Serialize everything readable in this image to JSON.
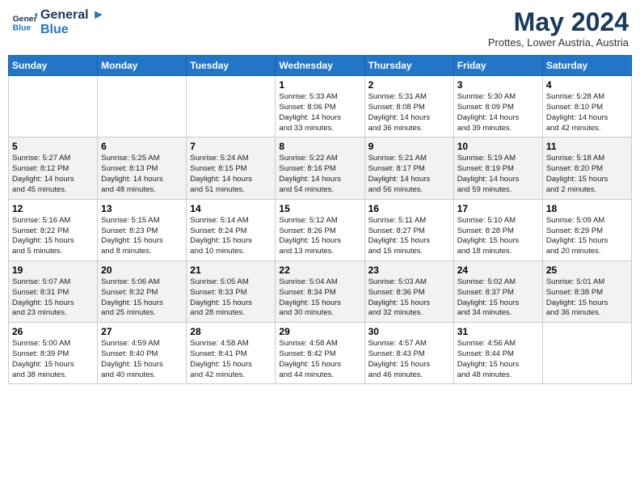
{
  "logo": {
    "line1": "General",
    "line2": "Blue"
  },
  "title": "May 2024",
  "subtitle": "Prottes, Lower Austria, Austria",
  "days_of_week": [
    "Sunday",
    "Monday",
    "Tuesday",
    "Wednesday",
    "Thursday",
    "Friday",
    "Saturday"
  ],
  "weeks": [
    [
      {
        "day": "",
        "info": ""
      },
      {
        "day": "",
        "info": ""
      },
      {
        "day": "",
        "info": ""
      },
      {
        "day": "1",
        "info": "Sunrise: 5:33 AM\nSunset: 8:06 PM\nDaylight: 14 hours\nand 33 minutes."
      },
      {
        "day": "2",
        "info": "Sunrise: 5:31 AM\nSunset: 8:08 PM\nDaylight: 14 hours\nand 36 minutes."
      },
      {
        "day": "3",
        "info": "Sunrise: 5:30 AM\nSunset: 8:09 PM\nDaylight: 14 hours\nand 39 minutes."
      },
      {
        "day": "4",
        "info": "Sunrise: 5:28 AM\nSunset: 8:10 PM\nDaylight: 14 hours\nand 42 minutes."
      }
    ],
    [
      {
        "day": "5",
        "info": "Sunrise: 5:27 AM\nSunset: 8:12 PM\nDaylight: 14 hours\nand 45 minutes."
      },
      {
        "day": "6",
        "info": "Sunrise: 5:25 AM\nSunset: 8:13 PM\nDaylight: 14 hours\nand 48 minutes."
      },
      {
        "day": "7",
        "info": "Sunrise: 5:24 AM\nSunset: 8:15 PM\nDaylight: 14 hours\nand 51 minutes."
      },
      {
        "day": "8",
        "info": "Sunrise: 5:22 AM\nSunset: 8:16 PM\nDaylight: 14 hours\nand 54 minutes."
      },
      {
        "day": "9",
        "info": "Sunrise: 5:21 AM\nSunset: 8:17 PM\nDaylight: 14 hours\nand 56 minutes."
      },
      {
        "day": "10",
        "info": "Sunrise: 5:19 AM\nSunset: 8:19 PM\nDaylight: 14 hours\nand 59 minutes."
      },
      {
        "day": "11",
        "info": "Sunrise: 5:18 AM\nSunset: 8:20 PM\nDaylight: 15 hours\nand 2 minutes."
      }
    ],
    [
      {
        "day": "12",
        "info": "Sunrise: 5:16 AM\nSunset: 8:22 PM\nDaylight: 15 hours\nand 5 minutes."
      },
      {
        "day": "13",
        "info": "Sunrise: 5:15 AM\nSunset: 8:23 PM\nDaylight: 15 hours\nand 8 minutes."
      },
      {
        "day": "14",
        "info": "Sunrise: 5:14 AM\nSunset: 8:24 PM\nDaylight: 15 hours\nand 10 minutes."
      },
      {
        "day": "15",
        "info": "Sunrise: 5:12 AM\nSunset: 8:26 PM\nDaylight: 15 hours\nand 13 minutes."
      },
      {
        "day": "16",
        "info": "Sunrise: 5:11 AM\nSunset: 8:27 PM\nDaylight: 15 hours\nand 15 minutes."
      },
      {
        "day": "17",
        "info": "Sunrise: 5:10 AM\nSunset: 8:28 PM\nDaylight: 15 hours\nand 18 minutes."
      },
      {
        "day": "18",
        "info": "Sunrise: 5:09 AM\nSunset: 8:29 PM\nDaylight: 15 hours\nand 20 minutes."
      }
    ],
    [
      {
        "day": "19",
        "info": "Sunrise: 5:07 AM\nSunset: 8:31 PM\nDaylight: 15 hours\nand 23 minutes."
      },
      {
        "day": "20",
        "info": "Sunrise: 5:06 AM\nSunset: 8:32 PM\nDaylight: 15 hours\nand 25 minutes."
      },
      {
        "day": "21",
        "info": "Sunrise: 5:05 AM\nSunset: 8:33 PM\nDaylight: 15 hours\nand 28 minutes."
      },
      {
        "day": "22",
        "info": "Sunrise: 5:04 AM\nSunset: 8:34 PM\nDaylight: 15 hours\nand 30 minutes."
      },
      {
        "day": "23",
        "info": "Sunrise: 5:03 AM\nSunset: 8:36 PM\nDaylight: 15 hours\nand 32 minutes."
      },
      {
        "day": "24",
        "info": "Sunrise: 5:02 AM\nSunset: 8:37 PM\nDaylight: 15 hours\nand 34 minutes."
      },
      {
        "day": "25",
        "info": "Sunrise: 5:01 AM\nSunset: 8:38 PM\nDaylight: 15 hours\nand 36 minutes."
      }
    ],
    [
      {
        "day": "26",
        "info": "Sunrise: 5:00 AM\nSunset: 8:39 PM\nDaylight: 15 hours\nand 38 minutes."
      },
      {
        "day": "27",
        "info": "Sunrise: 4:59 AM\nSunset: 8:40 PM\nDaylight: 15 hours\nand 40 minutes."
      },
      {
        "day": "28",
        "info": "Sunrise: 4:58 AM\nSunset: 8:41 PM\nDaylight: 15 hours\nand 42 minutes."
      },
      {
        "day": "29",
        "info": "Sunrise: 4:58 AM\nSunset: 8:42 PM\nDaylight: 15 hours\nand 44 minutes."
      },
      {
        "day": "30",
        "info": "Sunrise: 4:57 AM\nSunset: 8:43 PM\nDaylight: 15 hours\nand 46 minutes."
      },
      {
        "day": "31",
        "info": "Sunrise: 4:56 AM\nSunset: 8:44 PM\nDaylight: 15 hours\nand 48 minutes."
      },
      {
        "day": "",
        "info": ""
      }
    ]
  ]
}
